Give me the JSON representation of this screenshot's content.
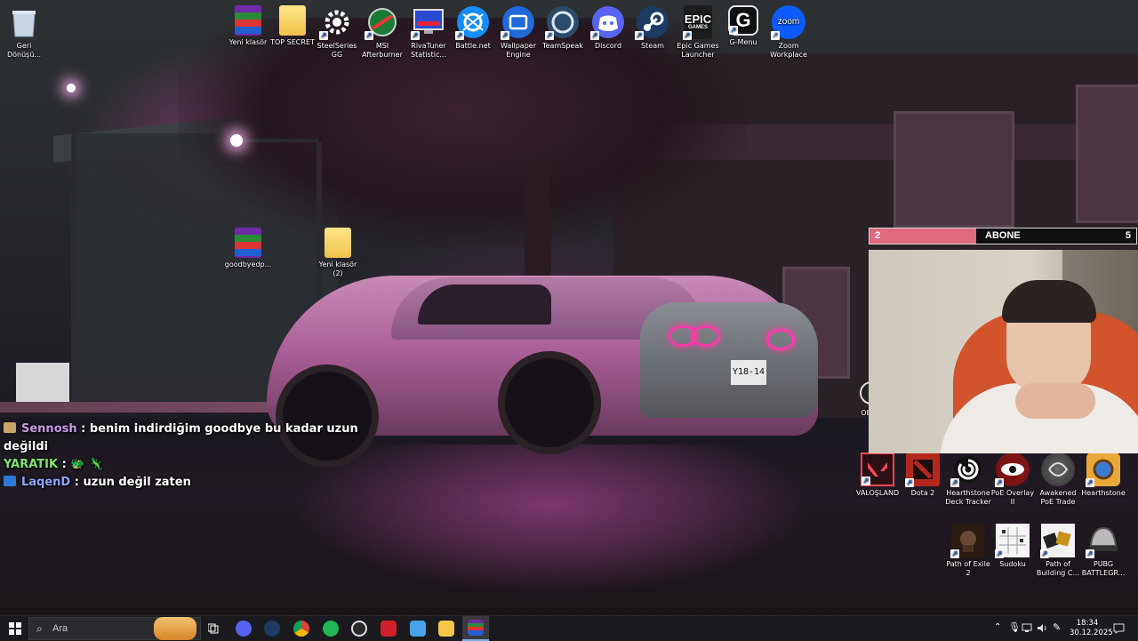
{
  "desktop": {
    "recycle_bin": "Geri Dönüşü...",
    "top_icons": [
      {
        "label": "Yeni klasör",
        "icon": "folder-zip-icon"
      },
      {
        "label": "TOP SECRET",
        "icon": "folder-icon"
      },
      {
        "label": "SteelSeries GG",
        "icon": "steelseries-icon"
      },
      {
        "label": "MSI Afterburner",
        "icon": "msi-afterburner-icon"
      },
      {
        "label": "RivaTuner Statistic...",
        "icon": "rivatuner-icon"
      },
      {
        "label": "Battle.net",
        "icon": "battlenet-icon"
      },
      {
        "label": "Wallpaper Engine",
        "icon": "wallpaper-engine-icon"
      },
      {
        "label": "TeamSpeak",
        "icon": "teamspeak-icon"
      },
      {
        "label": "Discord",
        "icon": "discord-icon"
      },
      {
        "label": "Steam",
        "icon": "steam-icon"
      },
      {
        "label": "Epic Games Launcher",
        "icon": "epic-games-icon",
        "glyph": "EPIC",
        "subglyph": "GAMES"
      },
      {
        "label": "G-Menu",
        "icon": "g-menu-icon",
        "glyph": "G"
      },
      {
        "label": "Zoom Workplace",
        "icon": "zoom-icon",
        "glyph": "zoom"
      }
    ],
    "middle_icons": [
      {
        "label": "goodbyedp...",
        "icon": "winrar-archive-icon"
      },
      {
        "label": "Yeni klasör (2)",
        "icon": "folder-icon"
      }
    ],
    "partial_icon_label": "OB",
    "right_row1": [
      {
        "label": "VALOŞLAND",
        "icon": "valorant-icon"
      },
      {
        "label": "Dota 2",
        "icon": "dota2-icon"
      },
      {
        "label": "Hearthstone Deck Tracker",
        "icon": "hdt-icon"
      },
      {
        "label": "PoE Overlay II",
        "icon": "poe-overlay-icon"
      },
      {
        "label": "Awakened PoE Trade",
        "icon": "awakened-poe-icon"
      },
      {
        "label": "Hearthstone",
        "icon": "hearthstone-icon"
      }
    ],
    "right_row2": [
      {
        "label": "Path of Exile 2",
        "icon": "path-of-exile-icon"
      },
      {
        "label": "Sudoku",
        "icon": "sudoku-icon"
      },
      {
        "label": "Path of Building C...",
        "icon": "path-of-building-icon"
      },
      {
        "label": "PUBG BATTLEGR...",
        "icon": "pubg-icon"
      }
    ]
  },
  "chat": {
    "messages": [
      {
        "user": "Sennosh",
        "sep": ":",
        "text": "benim indirdiğim goodbye bu kadar uzun değildi"
      },
      {
        "user": "YARATIK",
        "sep": ":",
        "text": "🐲 🦎"
      },
      {
        "user": "LaqenD",
        "sep": ":",
        "text": "uzun değil zaten"
      }
    ]
  },
  "overlay": {
    "sub_current": "2",
    "sub_label": "ABONE",
    "sub_goal": "5",
    "sub_progress": 0.4,
    "accent": "#e0687f"
  },
  "taskbar": {
    "search_placeholder": "Ara",
    "time": "18:34",
    "date": "30.12.2025",
    "apps": [
      "start-icon",
      "task-view-icon",
      "discord-icon",
      "steam-icon",
      "chrome-icon",
      "spotify-icon",
      "steelseries-icon",
      "app-red-icon",
      "app-blue-icon",
      "file-explorer-icon",
      "winrar-icon"
    ]
  }
}
